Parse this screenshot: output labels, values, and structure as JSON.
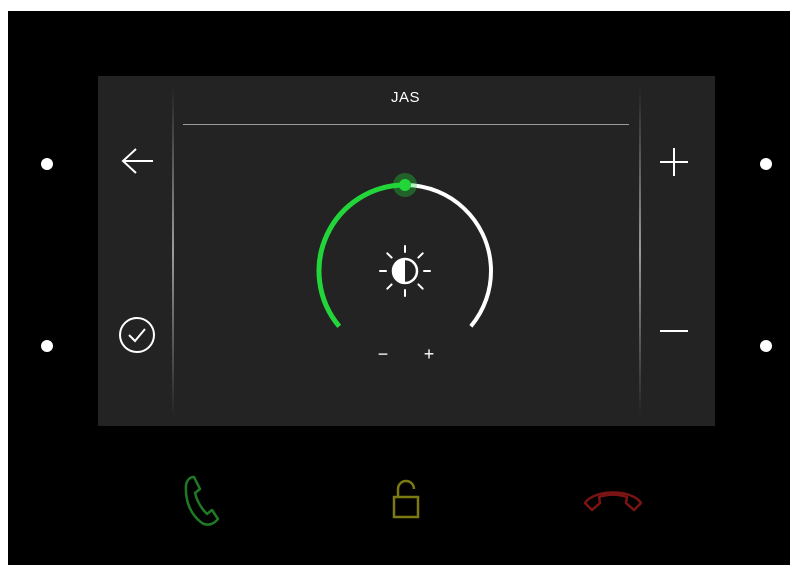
{
  "screen": {
    "title": "JAS"
  },
  "brightness": {
    "level": 0.5,
    "min_label": "−",
    "max_label": "+"
  },
  "icons": {
    "back": "arrow-left-icon",
    "confirm": "check-circle-icon",
    "increase": "plus-icon",
    "decrease": "minus-icon",
    "brightness": "brightness-icon",
    "call_accept": "phone-accept-icon",
    "unlock": "unlock-icon",
    "call_end": "phone-hangup-icon"
  },
  "colors": {
    "device_bg": "#000000",
    "screen_bg": "#232323",
    "arc_active": "#22d63a",
    "arc_inactive": "#ffffff",
    "call_accept": "#1f7a24",
    "unlock": "#7a7a10",
    "call_end": "#7a1414"
  }
}
